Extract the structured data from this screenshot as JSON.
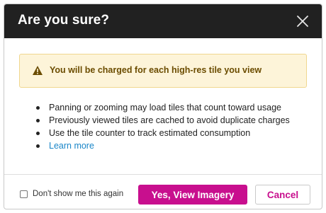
{
  "dialog": {
    "title": "Are you sure?",
    "close_icon": "close-icon"
  },
  "warning": {
    "icon": "warning-icon",
    "text": "You will be charged for each high-res tile you view"
  },
  "bullets": [
    "Panning or zooming may load tiles that count toward usage",
    "Previously viewed tiles are cached to avoid duplicate charges",
    "Use the tile counter to track estimated consumption"
  ],
  "learn_more": "Learn more",
  "footer": {
    "checkbox_label": "Don't show me this again",
    "checkbox_checked": false,
    "primary_label": "Yes, View Imagery",
    "secondary_label": "Cancel"
  },
  "colors": {
    "header_bg": "#212121",
    "accent": "#c80f8e",
    "warning_bg": "#fdf4d9",
    "warning_border": "#f0d78f",
    "warning_text": "#6b4c00",
    "link": "#1a86c8"
  }
}
